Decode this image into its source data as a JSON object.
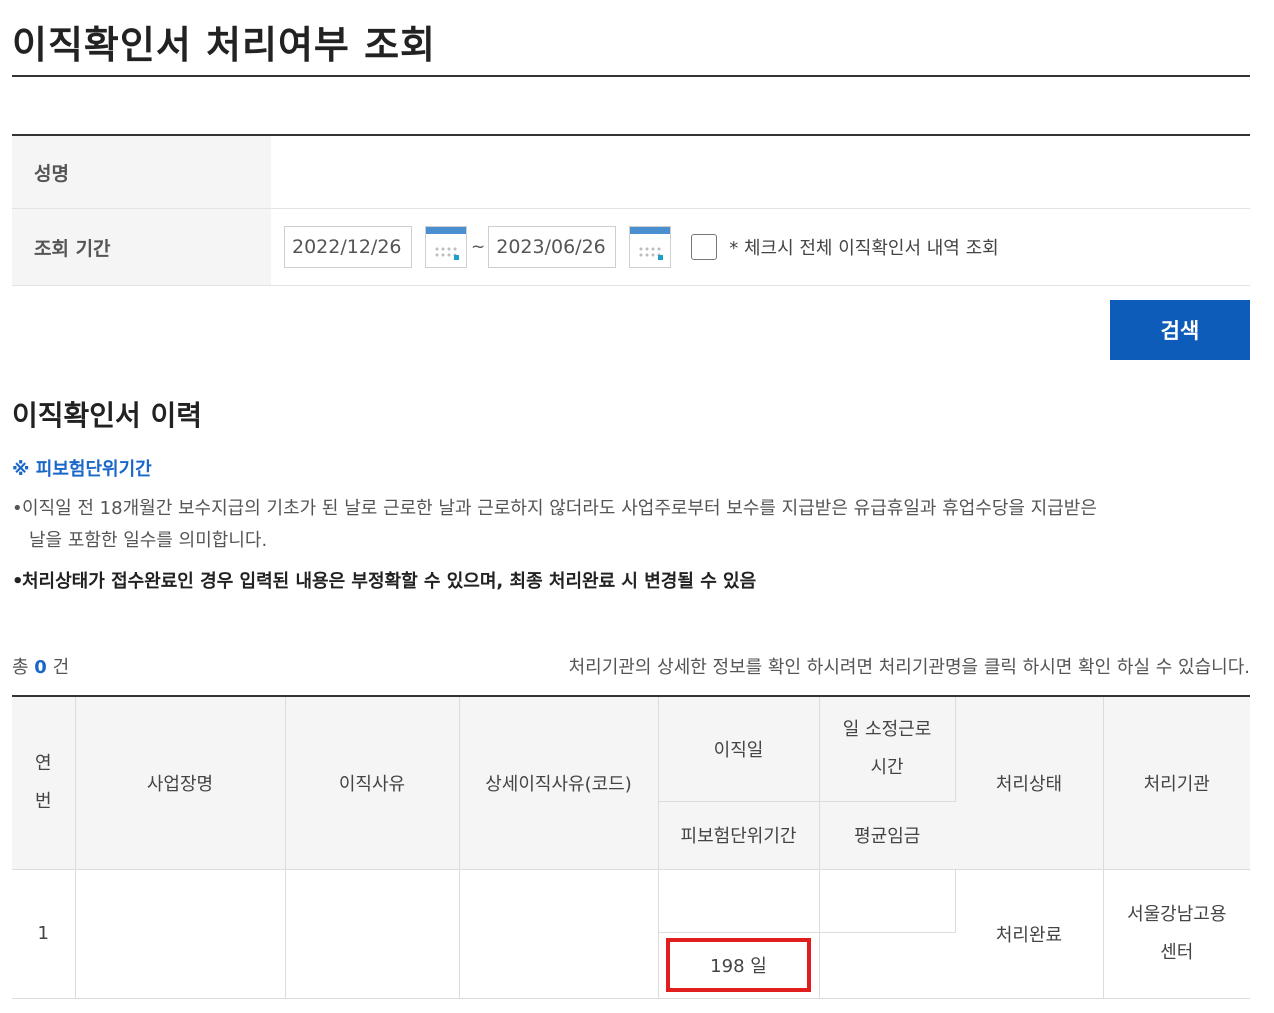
{
  "page_title": "이직확인서 처리여부 조회",
  "form": {
    "name_label": "성명",
    "name_value": "",
    "period_label": "조회 기간",
    "start_date": "2022/12/26",
    "end_date": "2023/06/26",
    "range_separator": "~",
    "checkbox_label": "* 체크시 전체 이직확인서 내역 조회",
    "checkbox_checked": false
  },
  "search_button": "검색",
  "history": {
    "title": "이직확인서 이력",
    "notice_heading": "※ 피보험단위기간",
    "bullets": [
      "이직일 전 18개월간 보수지급의 기초가 된 날로 근로한 날과 근로하지 않더라도 사업주로부터 보수를 지급받은 유급휴일과 휴업수당을 지급받은",
      "날을 포함한 일수를 의미합니다.",
      "처리상태가 접수완료인 경우 입력된 내용은 부정확할 수 있으며, 최종 처리완료 시 변경될 수 있음"
    ],
    "count_prefix": "총",
    "count_value": "0",
    "count_suffix": "건",
    "hint": "처리기관의 상세한 정보를 확인 하시려면 처리기관명을 클릭 하시면 확인 하실 수 있습니다."
  },
  "table": {
    "headers": {
      "no_line1": "연",
      "no_line2": "번",
      "workplace": "사업장명",
      "reason": "이직사유",
      "detail_reason": "상세이직사유(코드)",
      "leave_date": "이직일",
      "daily_hours_line1": "일 소정근로",
      "daily_hours_line2": "시간",
      "status": "처리상태",
      "agency": "처리기관",
      "insured_period": "피보험단위기간",
      "avg_wage": "평균임금"
    },
    "rows": [
      {
        "no": "1",
        "workplace": "",
        "reason": "",
        "detail_reason": "",
        "leave_date": "",
        "daily_hours": "",
        "insured_period": "198 일",
        "avg_wage": "",
        "status": "처리완료",
        "agency_line1": "서울강남고용",
        "agency_line2": "센터"
      }
    ]
  },
  "colors": {
    "primary_button": "#0d5cb9",
    "link_blue": "#1a67c9",
    "highlight_red": "#e01e1e"
  }
}
